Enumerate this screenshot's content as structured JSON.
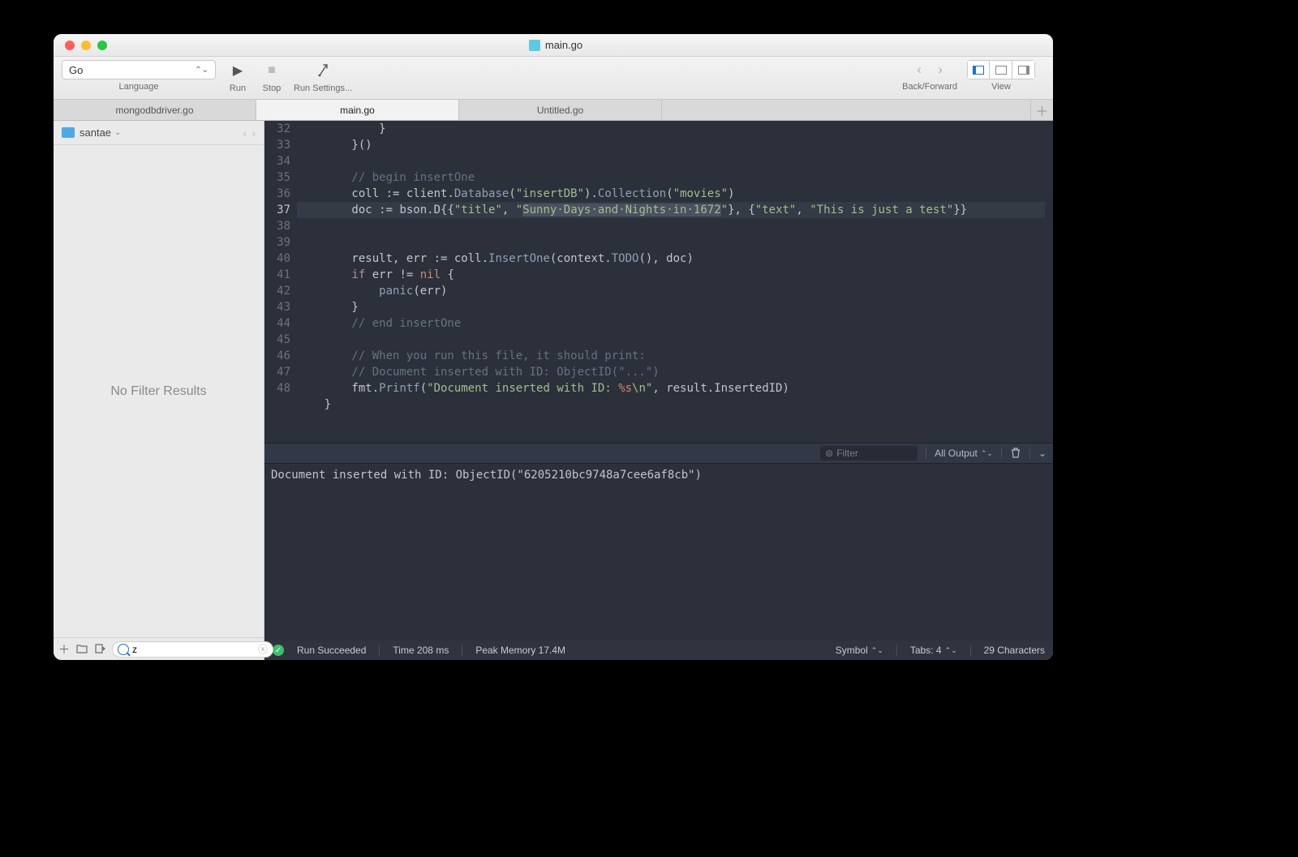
{
  "window": {
    "title": "main.go"
  },
  "toolbar": {
    "language": "Go",
    "language_label": "Language",
    "run_label": "Run",
    "stop_label": "Stop",
    "runset_label": "Run Settings...",
    "backfwd_label": "Back/Forward",
    "view_label": "View"
  },
  "tabs": {
    "t0": "mongodbdriver.go",
    "t1": "main.go",
    "t2": "Untitled.go"
  },
  "sidebar": {
    "project": "santae",
    "empty": "No Filter Results",
    "search_value": "z"
  },
  "code": {
    "lines": {
      "32": "            }",
      "33": "        }()",
      "34": "",
      "35_cm": "        // begin insertOne",
      "36_a": "        coll ",
      "36_b": ":= client.",
      "36_db": "Database",
      "36_c": "(",
      "36_s1": "\"insertDB\"",
      "36_d": ").",
      "36_col": "Collection",
      "36_e": "(",
      "36_s2": "\"movies\"",
      "36_f": ")",
      "37_a": "        doc ",
      "37_b": ":= bson.D{{",
      "37_s1": "\"title\"",
      "37_c": ", ",
      "37_q1": "\"",
      "37_sel": "Sunny·Days·and·Nights·in·1672",
      "37_q2": "\"",
      "37_d": "}, {",
      "37_s2": "\"text\"",
      "37_e": ", ",
      "37_s3": "\"This is just a test\"",
      "37_f": "}}",
      "38": "",
      "39_a": "        result, err ",
      "39_b": ":= coll.",
      "39_fn": "InsertOne",
      "39_c": "(context.",
      "39_todo": "TODO",
      "39_d": "(), doc)",
      "40_a": "        ",
      "40_if": "if",
      "40_b": " err != ",
      "40_nil": "nil",
      "40_c": " {",
      "41_a": "            ",
      "41_fn": "panic",
      "41_b": "(err)",
      "42": "        }",
      "43_cm": "        // end insertOne",
      "44": "",
      "45_cm": "        // When you run this file, it should print:",
      "46_cm": "        // Document inserted with ID: ObjectID(\"...\")",
      "47_a": "        fmt.",
      "47_fn": "Printf",
      "47_b": "(",
      "47_s1": "\"Document inserted with ID: ",
      "47_fmt": "%s",
      "47_s2": "\\n\"",
      "47_c": ", result.InsertedID)",
      "48": "    }"
    },
    "gutter": [
      "32",
      "33",
      "34",
      "35",
      "36",
      "37",
      "38",
      "39",
      "40",
      "41",
      "42",
      "43",
      "44",
      "45",
      "46",
      "47",
      "48"
    ]
  },
  "console_tb": {
    "filter_placeholder": "Filter",
    "all_output": "All Output"
  },
  "console": {
    "out": "Document inserted with ID: ObjectID(\"6205210bc9748a7cee6af8cb\")"
  },
  "status": {
    "run": "Run Succeeded",
    "time": "Time 208 ms",
    "mem": "Peak Memory 17.4M",
    "symbol": "Symbol",
    "tabs": "Tabs: 4",
    "chars": "29 Characters"
  }
}
